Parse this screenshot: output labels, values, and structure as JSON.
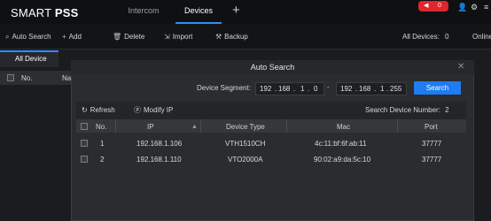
{
  "app": {
    "logo_light": "SMART ",
    "logo_bold": "PSS"
  },
  "tabs": [
    {
      "label": "Intercom"
    },
    {
      "label": "Devices"
    }
  ],
  "top_right": {
    "notification_count": "0"
  },
  "toolbar": {
    "auto_search": "Auto Search",
    "add": "Add",
    "delete": "Delete",
    "import": "Import",
    "backup": "Backup",
    "all_devices_label": "All Devices:",
    "all_devices_count": "0",
    "online_label": "Online"
  },
  "left_panel": {
    "tab": "All Device",
    "col_no": "No.",
    "col_na": "Na"
  },
  "dialog": {
    "title": "Auto Search",
    "segment_label": "Device Segment:",
    "start_ip": [
      "192",
      "168",
      "1",
      "0"
    ],
    "end_ip": [
      "192",
      "168",
      "1",
      "255"
    ],
    "search_button": "Search",
    "refresh": "Refresh",
    "modify_ip": "Modify IP",
    "device_number_label": "Search Device Number:",
    "device_number": "2",
    "columns": [
      "No.",
      "IP",
      "Device Type",
      "Mac",
      "Port"
    ],
    "rows": [
      {
        "no": "1",
        "ip": "192.168.1.106",
        "type": "VTH1510CH",
        "mac": "4c:11:bf:6f:ab:11",
        "port": "37777"
      },
      {
        "no": "2",
        "ip": "192.168.1.110",
        "type": "VTO2000A",
        "mac": "90:02:a9:da:5c:10",
        "port": "37777"
      }
    ]
  }
}
